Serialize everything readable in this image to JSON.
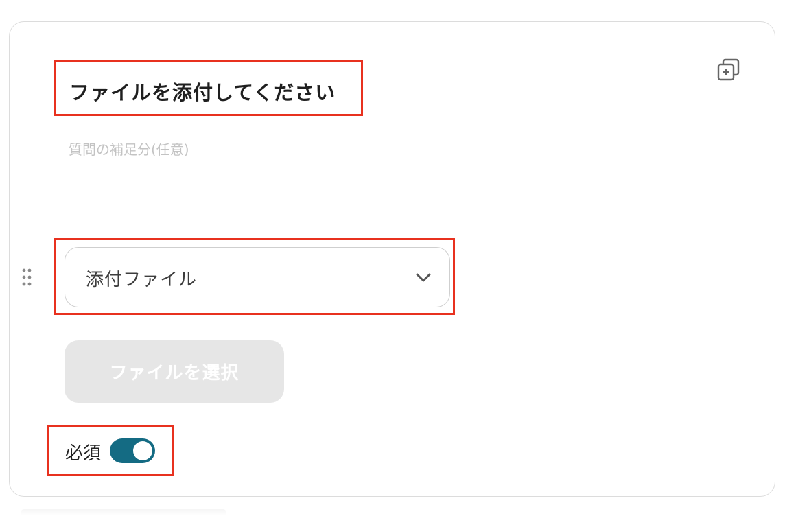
{
  "question": {
    "title": "ファイルを添付してください",
    "description_placeholder": "質問の補足分(任意)"
  },
  "answer_type": {
    "selected": "添付ファイル"
  },
  "file_button": {
    "label": "ファイルを選択"
  },
  "required": {
    "label": "必須",
    "enabled": true
  },
  "icons": {
    "copy": "duplicate-icon",
    "drag": "drag-handle-icon",
    "dropdown": "chevron-down-icon"
  },
  "colors": {
    "highlight": "#e8311f",
    "toggle_on": "#146b83",
    "button_disabled": "#e6e6e6"
  }
}
